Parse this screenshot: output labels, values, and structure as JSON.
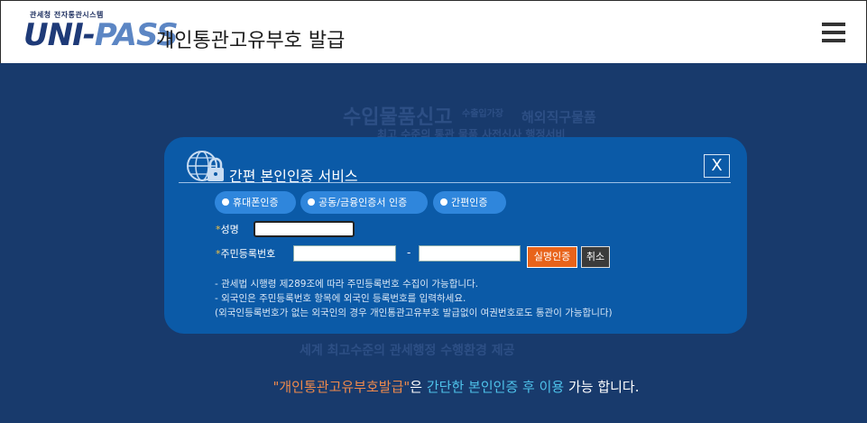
{
  "header": {
    "logo_subtitle": "관세청 전자통관시스템",
    "logo_part1": "UNI-",
    "logo_part2": "PASS",
    "title": "개인통관고유부호 발급",
    "menu_icon": "hamburger-icon"
  },
  "background": {
    "line1": "수입물품신고",
    "line1_small": "수출입가장",
    "line1_b": "해외직구물품",
    "line2": "최고 수준의 통관 물품 사전신사 행정서비",
    "line3": "세계 최고수준의 관세행정 수행환경 제공"
  },
  "modal": {
    "title": "간편 본인인증 서비스",
    "icon": "globe-lock-icon",
    "close_label": "X",
    "tabs": [
      "휴대폰인증",
      "공동/금융인증서 인증",
      "간편인증"
    ],
    "name_label": "성명",
    "rrn_label": "주민등록번호",
    "required_mark": "*",
    "dash": "-",
    "name_value": "",
    "rrn1_value": "",
    "rrn2_value": "",
    "verify_button": "실명인증",
    "cancel_button": "취소",
    "notes": [
      "- 관세법 시행령 제289조에 따라 주민등록번호 수집이 가능합니다.",
      "- 외국인은 주민등록번호 항목에 외국인 등록번호를 입력하세요.",
      "(외국인등록번호가 없는 외국인의 경우 개인통관고유부호 발급없이 여권번호로도 통관이 가능합니다)"
    ]
  },
  "footer_message": {
    "part1": "\"개인통관고유부호발급\"",
    "part2": "은 ",
    "part3": "간단한 본인인증 후 이용",
    "part4": " 가능 합니다."
  },
  "colors": {
    "background": "#183a6c",
    "modal": "#0b5aa7",
    "tab": "#2f86dc",
    "verify": "#e8631a",
    "accent_orange": "#f08a4b",
    "accent_cyan": "#4ec2ea"
  }
}
